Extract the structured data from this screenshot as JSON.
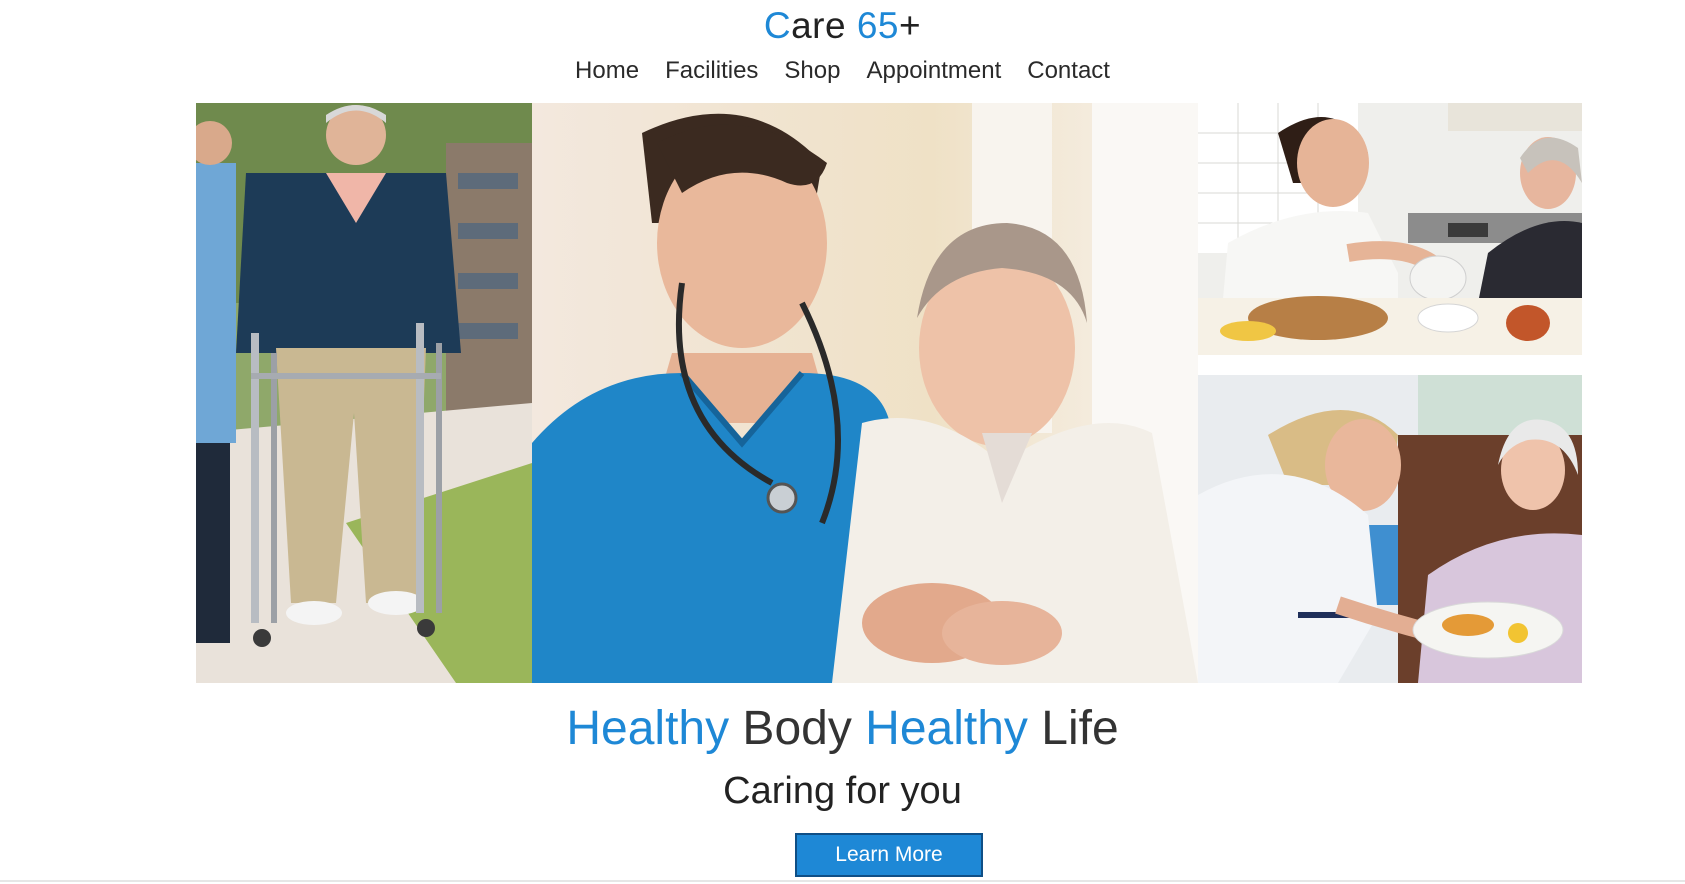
{
  "brand": {
    "prefix_accent": "C",
    "prefix_rest": "are ",
    "number": "65",
    "suffix": "+",
    "accent_color": "#1e88d6"
  },
  "nav": {
    "items": [
      {
        "label": "Home"
      },
      {
        "label": "Facilities"
      },
      {
        "label": "Shop"
      },
      {
        "label": "Appointment"
      },
      {
        "label": "Contact"
      }
    ]
  },
  "hero": {
    "headline_word_1": "Healthy",
    "headline_word_2": " Body ",
    "headline_word_3": "Healthy",
    "headline_word_4": " Life",
    "subtitle": "Caring for you",
    "cta_label": "Learn More"
  }
}
